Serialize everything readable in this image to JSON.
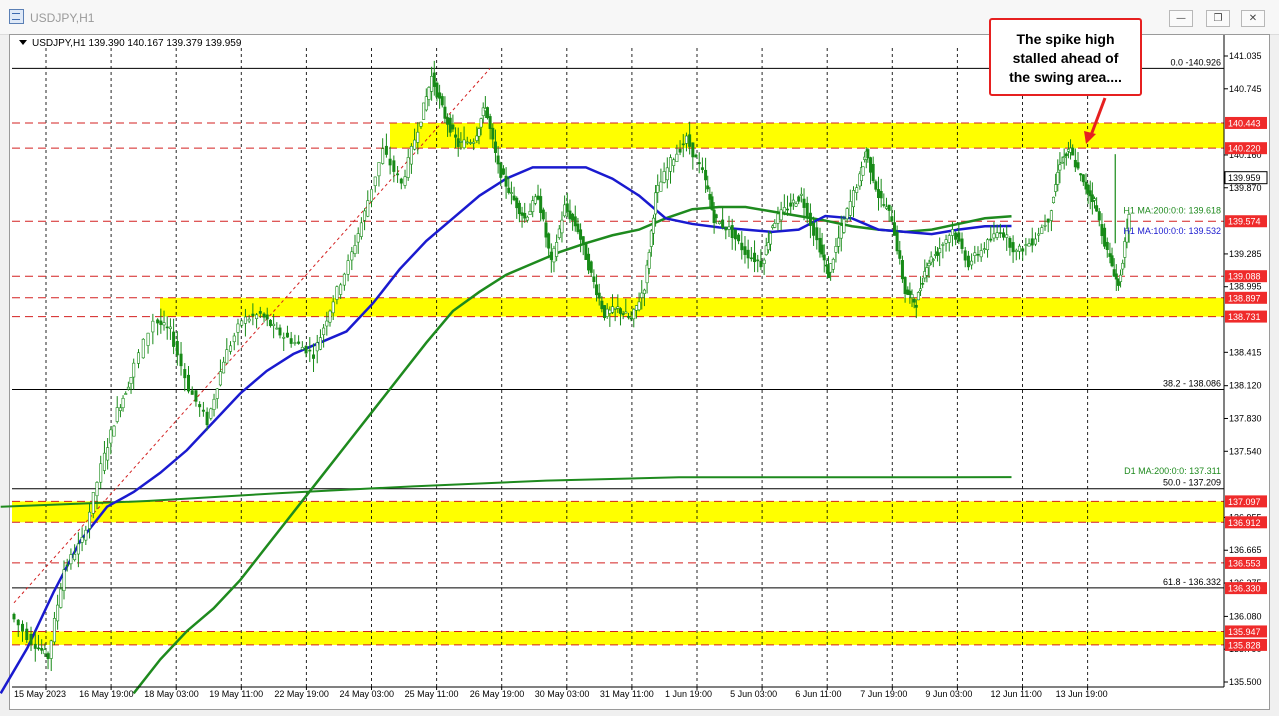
{
  "window": {
    "title": "USDJPY,H1",
    "buttons": [
      "—",
      "❐",
      "✕"
    ]
  },
  "symbol_info": "USDJPY,H1  139.390 140.167 139.379 139.959",
  "annotation": {
    "lines": [
      "The spike high",
      "stalled ahead of",
      "the swing area...."
    ]
  },
  "colors": {
    "zone": "#ffff00",
    "red_line": "#d32020",
    "ma100": "#1a1acf",
    "ma200": "#1e8a1e",
    "candle": "#178a17",
    "fib": "#000000",
    "price_tag": "#ef2b2b"
  },
  "chart_data": {
    "type": "candlestick",
    "ylim": [
      135.5,
      141.1
    ],
    "x_ticks": [
      "15 May 2023",
      "16 May 19:00",
      "18 May 03:00",
      "19 May 11:00",
      "22 May 19:00",
      "24 May 03:00",
      "25 May 11:00",
      "26 May 19:00",
      "30 May 03:00",
      "31 May 11:00",
      "1 Jun 19:00",
      "5 Jun 03:00",
      "6 Jun 11:00",
      "7 Jun 19:00",
      "9 Jun 03:00",
      "12 Jun 11:00",
      "13 Jun 19:00"
    ],
    "y_ticks": [
      141.035,
      140.745,
      140.16,
      139.87,
      139.285,
      138.995,
      138.415,
      138.12,
      137.83,
      137.54,
      136.955,
      136.665,
      136.375,
      136.08,
      135.79,
      135.5
    ],
    "zones": [
      {
        "low": 140.22,
        "high": 140.443
      },
      {
        "low": 138.731,
        "high": 138.897
      },
      {
        "low": 136.912,
        "high": 137.097
      },
      {
        "low": 135.828,
        "high": 135.947
      }
    ],
    "red_levels": [
      140.443,
      140.22,
      139.574,
      139.088,
      138.897,
      138.731,
      137.097,
      136.912,
      136.553,
      135.947,
      135.828
    ],
    "price_tags": [
      {
        "label": "140.443",
        "value": 140.443
      },
      {
        "label": "140.220",
        "value": 140.22
      },
      {
        "label": "139.574",
        "value": 139.574
      },
      {
        "label": "139.088",
        "value": 139.088
      },
      {
        "label": "138.897",
        "value": 138.897
      },
      {
        "label": "138.731",
        "value": 138.731
      },
      {
        "label": "137.097",
        "value": 137.097
      },
      {
        "label": "136.912",
        "value": 136.912
      },
      {
        "label": "136.553",
        "value": 136.553
      },
      {
        "label": "136.330",
        "value": 136.33
      },
      {
        "label": "135.947",
        "value": 135.947
      },
      {
        "label": "135.828",
        "value": 135.828
      }
    ],
    "current_price": {
      "label": "139.959",
      "value": 139.959
    },
    "fib_levels": [
      {
        "label": "0.0 -140.926",
        "value": 140.926
      },
      {
        "label": "38.2 - 138.086",
        "value": 138.086
      },
      {
        "label": "50.0 - 137.209",
        "value": 137.209
      },
      {
        "label": "61.8 - 136.332",
        "value": 136.332
      }
    ],
    "ma_labels": [
      {
        "label": "H1 MA:200:0:0: 139.618",
        "value": 139.618
      },
      {
        "label": "H1 MA:100:0:0: 139.532",
        "value": 139.532
      },
      {
        "label": "D1 MA:200:0:0: 137.311",
        "value": 137.311
      }
    ],
    "price_path": [
      [
        0,
        136.1
      ],
      [
        0.8,
        135.86
      ],
      [
        1.4,
        135.72
      ],
      [
        2,
        136.5
      ],
      [
        2.7,
        136.75
      ],
      [
        3.4,
        137.4
      ],
      [
        4,
        137.9
      ],
      [
        4.5,
        138.2
      ],
      [
        5.4,
        138.7
      ],
      [
        6,
        138.6
      ],
      [
        6.7,
        138.1
      ],
      [
        7.4,
        137.8
      ],
      [
        8,
        138.35
      ],
      [
        8.7,
        138.7
      ],
      [
        9.4,
        138.75
      ],
      [
        10,
        138.6
      ],
      [
        10.7,
        138.5
      ],
      [
        11.4,
        138.4
      ],
      [
        12,
        138.8
      ],
      [
        12.7,
        139.2
      ],
      [
        13.3,
        139.65
      ],
      [
        14,
        140.2
      ],
      [
        14.7,
        139.9
      ],
      [
        15.3,
        140.4
      ],
      [
        15.8,
        140.85
      ],
      [
        16.3,
        140.5
      ],
      [
        16.8,
        140.25
      ],
      [
        17.4,
        140.3
      ],
      [
        17.8,
        140.6
      ],
      [
        18.3,
        140.05
      ],
      [
        18.8,
        139.8
      ],
      [
        19.3,
        139.6
      ],
      [
        19.8,
        139.8
      ],
      [
        20.3,
        139.2
      ],
      [
        20.8,
        139.7
      ],
      [
        21.3,
        139.5
      ],
      [
        21.8,
        139.1
      ],
      [
        22.3,
        138.75
      ],
      [
        22.8,
        138.8
      ],
      [
        23.3,
        138.7
      ],
      [
        23.8,
        139.0
      ],
      [
        24.2,
        139.8
      ],
      [
        24.8,
        140.1
      ],
      [
        25.4,
        140.3
      ],
      [
        26,
        140.0
      ],
      [
        26.4,
        139.6
      ],
      [
        27,
        139.5
      ],
      [
        27.6,
        139.3
      ],
      [
        28.2,
        139.2
      ],
      [
        28.6,
        139.55
      ],
      [
        29.2,
        139.7
      ],
      [
        29.7,
        139.8
      ],
      [
        30.3,
        139.4
      ],
      [
        30.7,
        139.1
      ],
      [
        31.2,
        139.5
      ],
      [
        31.8,
        139.9
      ],
      [
        32.1,
        140.2
      ],
      [
        32.6,
        139.8
      ],
      [
        33.1,
        139.6
      ],
      [
        33.6,
        138.95
      ],
      [
        34,
        138.85
      ],
      [
        34.4,
        139.2
      ],
      [
        34.8,
        139.3
      ],
      [
        35.4,
        139.5
      ],
      [
        36,
        139.2
      ],
      [
        36.6,
        139.35
      ],
      [
        37.2,
        139.5
      ],
      [
        37.8,
        139.3
      ],
      [
        38.4,
        139.4
      ],
      [
        39,
        139.6
      ],
      [
        39.4,
        140.1
      ],
      [
        39.8,
        140.2
      ],
      [
        40.3,
        139.9
      ],
      [
        40.7,
        139.75
      ],
      [
        41.2,
        139.3
      ],
      [
        41.6,
        139.0
      ],
      [
        42,
        139.6
      ]
    ],
    "ma100": [
      [
        -0.5,
        135.4
      ],
      [
        0.5,
        135.8
      ],
      [
        1.5,
        136.3
      ],
      [
        2.5,
        136.75
      ],
      [
        3.5,
        137.05
      ],
      [
        4.5,
        137.18
      ],
      [
        5.5,
        137.35
      ],
      [
        6.5,
        137.55
      ],
      [
        7.5,
        137.8
      ],
      [
        8.5,
        138.05
      ],
      [
        9.5,
        138.25
      ],
      [
        10.5,
        138.4
      ],
      [
        11.5,
        138.5
      ],
      [
        12.5,
        138.6
      ],
      [
        13.5,
        138.85
      ],
      [
        14.5,
        139.15
      ],
      [
        15.5,
        139.4
      ],
      [
        16.5,
        139.6
      ],
      [
        17.5,
        139.8
      ],
      [
        18.5,
        139.95
      ],
      [
        19.5,
        140.05
      ],
      [
        20.5,
        140.05
      ],
      [
        21.5,
        140.05
      ],
      [
        22.5,
        139.95
      ],
      [
        23.5,
        139.8
      ],
      [
        24.5,
        139.6
      ],
      [
        25.5,
        139.55
      ],
      [
        26.5,
        139.52
      ],
      [
        27.5,
        139.5
      ],
      [
        28.5,
        139.48
      ],
      [
        29.5,
        139.5
      ],
      [
        30.5,
        139.62
      ],
      [
        31.5,
        139.6
      ],
      [
        32.5,
        139.5
      ],
      [
        33.5,
        139.48
      ],
      [
        34.5,
        139.46
      ],
      [
        35.5,
        139.5
      ],
      [
        36.5,
        139.53
      ],
      [
        37.5,
        139.532
      ]
    ],
    "ma200": [
      [
        4.5,
        135.4
      ],
      [
        5.5,
        135.7
      ],
      [
        6.5,
        135.95
      ],
      [
        7.5,
        136.15
      ],
      [
        8.5,
        136.4
      ],
      [
        9.5,
        136.7
      ],
      [
        10.5,
        137.0
      ],
      [
        11.5,
        137.3
      ],
      [
        12.5,
        137.6
      ],
      [
        13.5,
        137.9
      ],
      [
        14.5,
        138.2
      ],
      [
        15.5,
        138.5
      ],
      [
        16.5,
        138.78
      ],
      [
        17.5,
        138.95
      ],
      [
        18.5,
        139.1
      ],
      [
        19.5,
        139.2
      ],
      [
        20.5,
        139.3
      ],
      [
        21.5,
        139.38
      ],
      [
        22.5,
        139.45
      ],
      [
        23.5,
        139.5
      ],
      [
        24.5,
        139.6
      ],
      [
        25.5,
        139.68
      ],
      [
        26.5,
        139.7
      ],
      [
        27.5,
        139.7
      ],
      [
        28.5,
        139.66
      ],
      [
        29.5,
        139.62
      ],
      [
        30.5,
        139.58
      ],
      [
        31.5,
        139.53
      ],
      [
        32.5,
        139.5
      ],
      [
        33.5,
        139.48
      ],
      [
        34.5,
        139.5
      ],
      [
        35.5,
        139.55
      ],
      [
        36.5,
        139.6
      ],
      [
        37.5,
        139.618
      ]
    ],
    "ma_d1": [
      [
        -0.5,
        137.05
      ],
      [
        5,
        137.1
      ],
      [
        10,
        137.17
      ],
      [
        15,
        137.23
      ],
      [
        20,
        137.28
      ],
      [
        25,
        137.31
      ],
      [
        30,
        137.31
      ],
      [
        35,
        137.31
      ],
      [
        37.5,
        137.311
      ]
    ],
    "trendline": [
      [
        0,
        136.2
      ],
      [
        17.9,
        140.926
      ]
    ]
  }
}
